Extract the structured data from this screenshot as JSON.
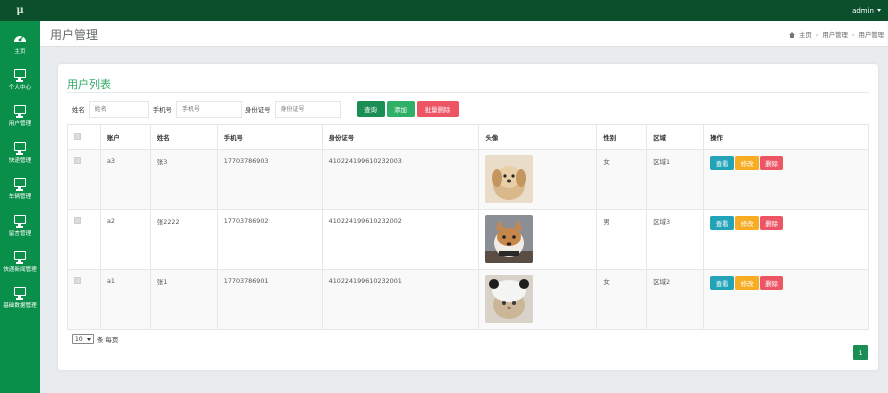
{
  "app": {
    "logo": "μ",
    "user": "admin"
  },
  "sidebar": {
    "items": [
      {
        "label": "主页",
        "icon": "dashboard-icon"
      },
      {
        "label": "个人中心",
        "icon": "monitor-icon"
      },
      {
        "label": "用户管理",
        "icon": "monitor-icon"
      },
      {
        "label": "快递管理",
        "icon": "monitor-icon"
      },
      {
        "label": "车辆管理",
        "icon": "monitor-icon"
      },
      {
        "label": "留言管理",
        "icon": "monitor-icon"
      },
      {
        "label": "快递新闻管理",
        "icon": "monitor-icon"
      },
      {
        "label": "基础数据管理",
        "icon": "monitor-icon"
      }
    ]
  },
  "header": {
    "title": "用户管理",
    "breadcrumb": [
      "主页",
      "用户管理",
      "用户管理"
    ]
  },
  "card": {
    "title": "用户列表"
  },
  "filters": {
    "name": {
      "label": "姓名",
      "placeholder": "姓名"
    },
    "phone": {
      "label": "手机号",
      "placeholder": "手机号"
    },
    "idcard": {
      "label": "身份证号",
      "placeholder": "身份证号"
    },
    "search_label": "查询",
    "add_label": "添加",
    "batch_delete_label": "批量删除"
  },
  "table": {
    "headers": [
      "",
      "账户",
      "姓名",
      "手机号",
      "身份证号",
      "头像",
      "性别",
      "区域",
      "操作"
    ],
    "rows": [
      {
        "account": "a3",
        "name": "张3",
        "phone": "17703786903",
        "idcard": "410224199610232003",
        "gender": "女",
        "region": "区域1",
        "avatar": "puppy-photo"
      },
      {
        "account": "a2",
        "name": "张2222",
        "phone": "17703786902",
        "idcard": "410224199610232002",
        "gender": "男",
        "region": "区域3",
        "avatar": "shiba-photo"
      },
      {
        "account": "a1",
        "name": "张1",
        "phone": "17703786901",
        "idcard": "410224199610232001",
        "gender": "女",
        "region": "区域2",
        "avatar": "cat-panda-hat-photo"
      }
    ],
    "actions": {
      "view": "查看",
      "edit": "修改",
      "delete": "删除"
    }
  },
  "pagination": {
    "page_size": "10",
    "per_page_label": "条 每页",
    "current_page": "1"
  },
  "colors": {
    "topbar": "#0b4f2d",
    "sidebar": "#0a8f4a",
    "title_green": "#2fa864",
    "search": "#1a8e54",
    "add": "#2eb067",
    "danger": "#ed5565",
    "info": "#23a3b8",
    "warning": "#f8ac22"
  }
}
